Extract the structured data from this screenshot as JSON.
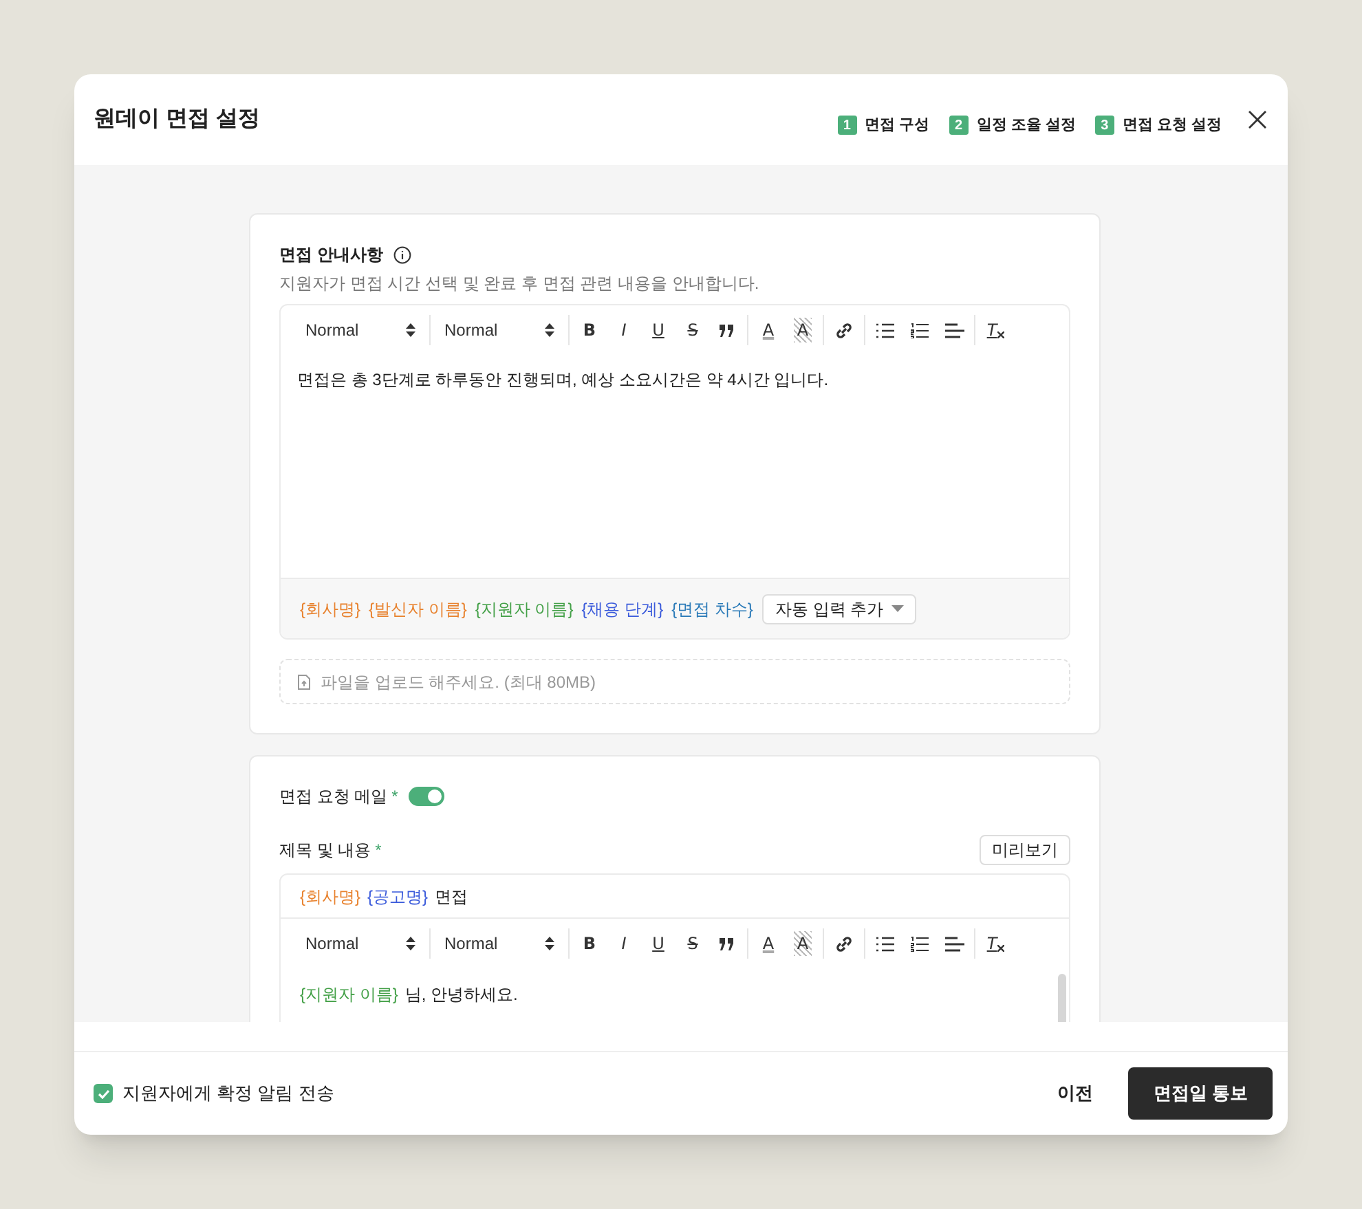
{
  "window": {
    "title": "원데이 면접 설정"
  },
  "steps": [
    {
      "number": "1",
      "label": "면접 구성"
    },
    {
      "number": "2",
      "label": "일정 조율 설정"
    },
    {
      "number": "3",
      "label": "면접 요청 설정"
    }
  ],
  "guide": {
    "title": "면접 안내사항",
    "description": "지원자가 면접 시간 선택 및 완료 후 면접 관련 내용을 안내합니다.",
    "toolbar": [
      [
        {
          "kind": "select",
          "label": "Normal"
        }
      ],
      [
        {
          "kind": "select",
          "label": "Normal"
        }
      ],
      [
        {
          "kind": "bold",
          "label": "B"
        },
        {
          "kind": "italic",
          "label": "I"
        },
        {
          "kind": "underline",
          "label": "U"
        },
        {
          "kind": "strike",
          "label": "S"
        },
        {
          "kind": "quote"
        }
      ],
      [
        {
          "kind": "color",
          "label": "A"
        },
        {
          "kind": "background",
          "label": "A"
        }
      ],
      [
        {
          "kind": "link"
        }
      ],
      [
        {
          "kind": "bullet"
        },
        {
          "kind": "ordered"
        },
        {
          "kind": "align"
        }
      ],
      [
        {
          "kind": "clean",
          "label": "T"
        }
      ]
    ],
    "body": "면접은 총 3단계로 하루동안 진행되며, 예상 소요시간은 약 4시간 입니다.",
    "variables": [
      {
        "text": "{회사명}",
        "color": "#e8822e"
      },
      {
        "text": "{발신자 이름}",
        "color": "#e8822e"
      },
      {
        "text": "{지원자 이름}",
        "color": "#43a047"
      },
      {
        "text": "{채용 단계}",
        "color": "#3b5bdb"
      },
      {
        "text": "{면접 차수}",
        "color": "#2a7ab8"
      }
    ],
    "add_variable": "자동 입력 추가",
    "upload": {
      "placeholder": "파일을 업로드 해주세요. (최대 80MB)"
    }
  },
  "mail": {
    "label": "면접 요청 메일",
    "required_mark": "*",
    "on": true,
    "content_label": "제목 및 내용",
    "content_required_mark": "*",
    "preview_button": "미리보기",
    "subject": [
      {
        "kind": "variable",
        "text": "{회사명}",
        "color": "#e8822e"
      },
      {
        "kind": "variable",
        "text": "{공고명}",
        "color": "#3b5bdb"
      },
      {
        "kind": "text",
        "text": "면접"
      }
    ],
    "toolbar": [
      [
        {
          "kind": "select",
          "label": "Normal"
        }
      ],
      [
        {
          "kind": "select",
          "label": "Normal"
        }
      ],
      [
        {
          "kind": "bold",
          "label": "B"
        },
        {
          "kind": "italic",
          "label": "I"
        },
        {
          "kind": "underline",
          "label": "U"
        },
        {
          "kind": "strike",
          "label": "S"
        },
        {
          "kind": "quote"
        }
      ],
      [
        {
          "kind": "color",
          "label": "A"
        },
        {
          "kind": "background",
          "label": "A"
        }
      ],
      [
        {
          "kind": "link"
        }
      ],
      [
        {
          "kind": "bullet"
        },
        {
          "kind": "ordered"
        },
        {
          "kind": "align"
        }
      ],
      [
        {
          "kind": "clean",
          "label": "T"
        }
      ]
    ],
    "body_lines": [
      [
        {
          "kind": "variable",
          "text": "{지원자 이름}",
          "color": "#43a047"
        },
        {
          "kind": "text",
          "text": "님, 안녕하세요."
        }
      ]
    ]
  },
  "footer": {
    "checkbox": {
      "label": "지원자에게 확정 알림 전송",
      "checked": true
    },
    "buttons": [
      {
        "label": "이전",
        "kind": "text"
      },
      {
        "label": "면접일 통보",
        "kind": "primary"
      }
    ]
  }
}
